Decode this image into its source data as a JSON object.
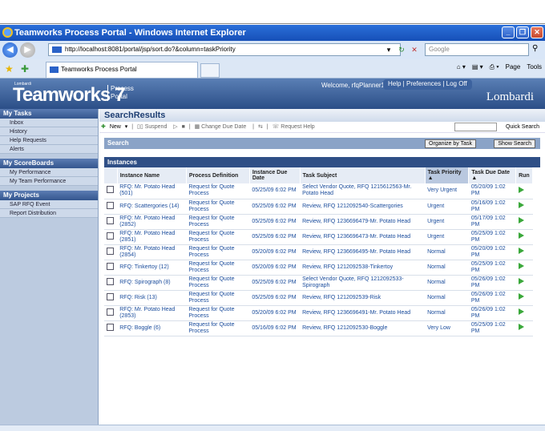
{
  "window": {
    "title": "Teamworks Process Portal - Windows Internet Explorer",
    "minimize": "_",
    "restore": "❐",
    "close": "✕"
  },
  "browser": {
    "url": "http://localhost:8081/portal/jsp/sort.do?&column=taskPriority",
    "search_placeholder": "Google",
    "tab_title": "Teamworks Process Portal",
    "page_menu": "Page",
    "tools_menu": "Tools"
  },
  "header": {
    "logo_small": "Lombardi",
    "logo": "Teamworks 7",
    "logo_sub_line1": "Process",
    "logo_sub_line2": "Portal",
    "welcome": "Welcome, rfqPlanner1",
    "links": "Help  |  Preferences  |  Log Off",
    "brand": "Lombardi"
  },
  "sidebar": {
    "my_tasks": "My Tasks",
    "task_items": [
      "Inbox",
      "History",
      "Help Requests",
      "Alerts"
    ],
    "scoreboards": "My ScoreBoards",
    "scoreboard_items": [
      "My Performance",
      "My Team Performance"
    ],
    "projects": "My Projects",
    "project_items": [
      "SAP RFQ Event",
      "Report Distribution"
    ]
  },
  "main": {
    "title": "SearchResults",
    "toolbar": {
      "new": "New",
      "suspend": "Suspend",
      "change_due_date": "Change Due Date",
      "request_help": "Request Help",
      "quick_search": "Quick Search"
    },
    "search_label": "Search",
    "organize_button": "Organize by Task",
    "show_search_button": "Show Search",
    "instances_label": "Instances",
    "columns": [
      "Instance Name",
      "Process Definition",
      "Instance Due Date",
      "Task Subject",
      "Task Priority",
      "Task Due Date",
      "Run"
    ],
    "rows": [
      [
        "RFQ: Mr. Potato Head (501)",
        "Request for Quote Process",
        "05/25/09 6:02 PM",
        "Select Vendor Quote, RFQ 1215612563-Mr. Potato Head",
        "Very Urgent",
        "05/20/09 1:02 PM"
      ],
      [
        "RFQ: Scattergories (14)",
        "Request for Quote Process",
        "05/25/09 6:02 PM",
        "Review, RFQ 1212092540-Scattergories",
        "Urgent",
        "05/16/09 1:02 PM"
      ],
      [
        "RFQ: Mr. Potato Head (2852)",
        "Request for Quote Process",
        "05/25/09 6:02 PM",
        "Review, RFQ 1236696479-Mr. Potato Head",
        "Urgent",
        "05/17/09 1:02 PM"
      ],
      [
        "RFQ: Mr. Potato Head (2851)",
        "Request for Quote Process",
        "05/25/09 6:02 PM",
        "Review, RFQ 1236696473-Mr. Potato Head",
        "Urgent",
        "05/25/09 1:02 PM"
      ],
      [
        "RFQ: Mr. Potato Head (2854)",
        "Request for Quote Process",
        "05/20/09 6:02 PM",
        "Review, RFQ 1236696495-Mr. Potato Head",
        "Normal",
        "05/20/09 1:02 PM"
      ],
      [
        "RFQ: Tinkertoy (12)",
        "Request for Quote Process",
        "05/20/09 6:02 PM",
        "Review, RFQ 1212092538-Tinkertoy",
        "Normal",
        "05/25/09 1:02 PM"
      ],
      [
        "RFQ: Spirograph (8)",
        "Request for Quote Process",
        "05/25/09 6:02 PM",
        "Select Vendor Quote, RFQ 1212092533-Spirograph",
        "Normal",
        "05/26/09 1:02 PM"
      ],
      [
        "RFQ: Risk (13)",
        "Request for Quote Process",
        "05/25/09 6:02 PM",
        "Review, RFQ 1212092539-Risk",
        "Normal",
        "05/26/09 1:02 PM"
      ],
      [
        "RFQ: Mr. Potato Head (2853)",
        "Request for Quote Process",
        "05/20/09 6:02 PM",
        "Review, RFQ 1236696491-Mr. Potato Head",
        "Normal",
        "05/26/09 1:02 PM"
      ],
      [
        "RFQ: Boggle (6)",
        "Request for Quote Process",
        "05/16/09 6:02 PM",
        "Review, RFQ 1212092530-Boggle",
        "Very Low",
        "05/25/09 1:02 PM"
      ]
    ]
  }
}
